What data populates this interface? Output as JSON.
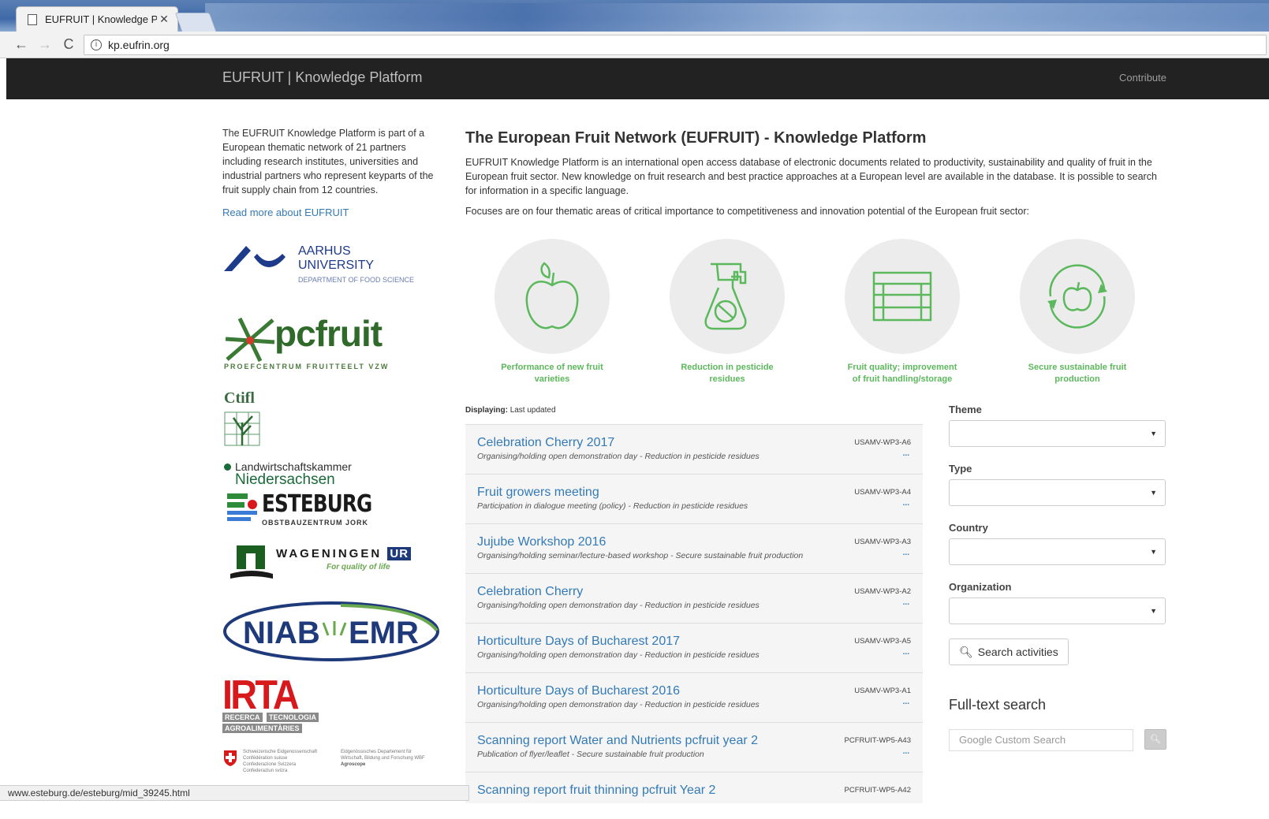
{
  "browser": {
    "tab_title": "EUFRUIT | Knowledge Pl",
    "url": "kp.eufrin.org",
    "status_url": "www.esteburg.de/esteburg/mid_39245.html"
  },
  "header": {
    "brand": "EUFRUIT | Knowledge Platform",
    "contribute": "Contribute"
  },
  "sidebar": {
    "intro": "The EUFRUIT Knowledge Platform is part of a European thematic network of 21 partners including research institutes, universities and industrial partners who represent keyparts of the fruit supply chain from 12 countries.",
    "read_more": "Read more about EUFRUIT",
    "partners": {
      "aarhus": [
        "AARHUS",
        "UNIVERSITY",
        "DEPARTMENT OF FOOD SCIENCE"
      ],
      "pcfruit": [
        "pcfruit",
        "PROEFCENTRUM FRUITTEELT VZW"
      ],
      "ctifl": "Ctifl",
      "lwk": [
        "Landwirtschaftskammer",
        "Niedersachsen"
      ],
      "esteburg": [
        "ESTEBURG",
        "OBSTBAUZENTRUM JORK"
      ],
      "wageningen": [
        "WAGENINGEN",
        "UR",
        "For quality of life"
      ],
      "niab": [
        "NIAB",
        "EMR"
      ],
      "irta": [
        "IRTA",
        "RECERCA",
        "TECNOLOGIA",
        "AGROALIMENTÀRIES"
      ],
      "swiss": [
        "Schweizerische Eidgenossenschaft",
        "Confédération suisse",
        "Confederazione Svizzera",
        "Confederaziun svizra",
        "Eidgenössisches Departement für",
        "Wirtschaft, Bildung und Forschung WBF",
        "Agroscope"
      ]
    }
  },
  "main": {
    "title": "The European Fruit Network (EUFRUIT) - Knowledge Platform",
    "description": "EUFRUIT Knowledge Platform is an international open access database of electronic documents related to productivity, sustainability and quality of fruit in the European fruit sector. New knowledge on fruit research and best practice approaches at a European level are available in the database. It is possible to search for information in a specific language.",
    "focus": "Focuses are on four thematic areas of critical importance to competitiveness and innovation potential of the European fruit sector:",
    "themes": [
      {
        "icon": "apple-icon",
        "label": "Performance of new fruit varieties"
      },
      {
        "icon": "spray-bottle-icon",
        "label": "Reduction in pesticide residues"
      },
      {
        "icon": "crate-icon",
        "label": "Fruit quality; improvement of fruit handling/storage"
      },
      {
        "icon": "recycle-apple-icon",
        "label": "Secure sustainable fruit production"
      }
    ],
    "displaying_label": "Displaying:",
    "displaying_value": "Last updated",
    "results": [
      {
        "title": "Celebration Cherry 2017",
        "subtitle": "Organising/holding open demonstration day - Reduction in pesticide residues",
        "code": "USAMV-WP3-A6",
        "more": "..."
      },
      {
        "title": "Fruit growers meeting",
        "subtitle": "Participation in dialogue meeting (policy) - Reduction in pesticide residues",
        "code": "USAMV-WP3-A4",
        "more": "..."
      },
      {
        "title": "Jujube Workshop 2016",
        "subtitle": "Organising/holding seminar/lecture-based workshop - Secure sustainable fruit production",
        "code": "USAMV-WP3-A3",
        "more": "..."
      },
      {
        "title": "Celebration Cherry",
        "subtitle": "Organising/holding open demonstration day - Reduction in pesticide residues",
        "code": "USAMV-WP3-A2",
        "more": "..."
      },
      {
        "title": "Horticulture Days of Bucharest 2017",
        "subtitle": "Organising/holding open demonstration day - Reduction in pesticide residues",
        "code": "USAMV-WP3-A5",
        "more": "..."
      },
      {
        "title": "Horticulture Days of Bucharest 2016",
        "subtitle": "Organising/holding open demonstration day - Reduction in pesticide residues",
        "code": "USAMV-WP3-A1",
        "more": "..."
      },
      {
        "title": "Scanning report Water and Nutrients pcfruit year 2",
        "subtitle": "Publication of flyer/leaflet - Secure sustainable fruit production",
        "code": "PCFRUIT-WP5-A43",
        "more": "..."
      },
      {
        "title": "Scanning report fruit thinning pcfruit Year 2",
        "subtitle": "",
        "code": "PCFRUIT-WP5-A42",
        "more": ""
      }
    ]
  },
  "filters": {
    "theme_label": "Theme",
    "type_label": "Type",
    "country_label": "Country",
    "organization_label": "Organization",
    "search_button": "Search activities",
    "fulltext_title": "Full-text search",
    "fulltext_placeholder": "Google Custom Search"
  },
  "colors": {
    "header_bg": "#222222",
    "link": "#337ab7",
    "theme_green": "#5cb85c"
  }
}
